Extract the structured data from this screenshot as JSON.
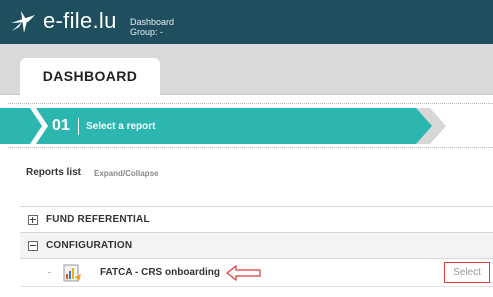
{
  "header": {
    "brand": "e-file.lu",
    "context_title": "Dashboard",
    "group_label": "Group: -",
    "logo_icon": "star-logo-icon"
  },
  "tabs": [
    {
      "label": "DASHBOARD",
      "active": true
    }
  ],
  "wizard": {
    "step_number": "01",
    "step_label": "Select a report",
    "color": "#2bb7b0"
  },
  "reports": {
    "title": "Reports list",
    "expand_collapse": "Expand/Collapse",
    "groups": [
      {
        "label": "FUND REFERENTIAL",
        "expanded": false
      },
      {
        "label": "CONFIGURATION",
        "expanded": true
      }
    ],
    "items": [
      {
        "label": "FATCA - CRS onboarding",
        "action": "Select",
        "icon": "report-chart-icon"
      }
    ]
  },
  "colors": {
    "header_bg": "#1f4e5f",
    "tab_strip_bg": "#d9d9d9",
    "accent_teal": "#2bb7b0",
    "highlight_red": "#e03a3a"
  }
}
